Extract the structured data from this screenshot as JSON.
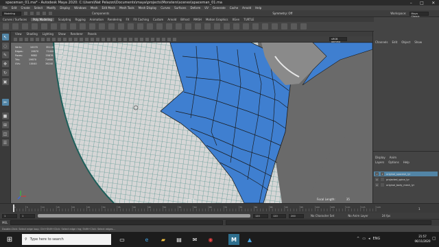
{
  "window": {
    "title": "spaceman_01.ma* - Autodesk Maya 2020: C:\\Users\\Nat Pelazzo\\Documents\\maya\\projects\\Monsters\\scenes\\spaceman_01.ma",
    "controls": [
      "–",
      "□",
      "✕"
    ]
  },
  "menubar": [
    "File",
    "Edit",
    "Create",
    "Select",
    "Modify",
    "Display",
    "Windows",
    "Mesh",
    "Edit Mesh",
    "Mesh Tools",
    "Mesh Display",
    "Curves",
    "Surfaces",
    "Deform",
    "UV",
    "Generate",
    "Cache",
    "Arnold",
    "Help"
  ],
  "status_line": {
    "mode": "Modeling",
    "components": "Components",
    "symmetry": "Symmetry: Off",
    "workspace_label": "Workspace:",
    "workspace": "Maya Classic"
  },
  "shelf_tabs": [
    "Curves / Surfaces",
    "Poly Modeling",
    "Sculpting",
    "Rigging",
    "Animation",
    "Rendering",
    "FX",
    "FX Caching",
    "Custom",
    "Arnold",
    "Bifrost",
    "MASH",
    "Motion Graphics",
    "XGen",
    "TURTLE"
  ],
  "shelf_active": "Poly Modeling",
  "panel_menu": [
    "View",
    "Shading",
    "Lighting",
    "Show",
    "Renderer",
    "Panels"
  ],
  "heads_up": {
    "headers": [
      "",
      "",
      "",
      ""
    ],
    "rows": [
      {
        "label": "Verts:",
        "a": "10070",
        "b": "35116",
        "c": "0"
      },
      {
        "label": "Edges:",
        "a": "19870",
        "b": "71000",
        "c": "0"
      },
      {
        "label": "Faces:",
        "a": "9882",
        "b": "35878",
        "c": "0"
      },
      {
        "label": "Tris:",
        "a": "19670",
        "b": "71666",
        "c": "0"
      },
      {
        "label": "UVs:",
        "a": "10040",
        "b": "36240",
        "c": "0"
      }
    ]
  },
  "camera_name": "persp",
  "focal_length": {
    "label": "Focal Length:",
    "value": "35"
  },
  "toolbar_fields": {
    "gamma": "sRGB gamma"
  },
  "channel_box": {
    "tabs": [
      "Channels",
      "Edit",
      "Object",
      "Show"
    ],
    "layer_tabs": [
      "Display",
      "Anim"
    ],
    "layer_menu": [
      "Layers",
      "Options",
      "Help"
    ],
    "layers": [
      {
        "vis": "V",
        "type": "P",
        "name": "original_spacesh_lyr",
        "selected": true
      },
      {
        "vis": "V",
        "type": "",
        "name": "projected_spine_lyr",
        "selected": false
      },
      {
        "vis": "V",
        "type": "",
        "name": "original_body_mesh_lyr",
        "selected": false
      }
    ]
  },
  "timeline": {
    "ticks": [
      "1",
      "5",
      "10",
      "15",
      "20",
      "25",
      "30",
      "35",
      "40",
      "45",
      "50",
      "55",
      "60",
      "65",
      "70",
      "75",
      "80",
      "85",
      "90",
      "95",
      "100",
      "105",
      "110",
      "115",
      "120"
    ],
    "current": "1"
  },
  "range": {
    "start": "1",
    "start2": "1",
    "end": "120",
    "end2": "120",
    "end3": "200",
    "char_set": "No Character Set",
    "anim_layer": "No Anim Layer",
    "fps": "24 fps"
  },
  "mel": {
    "label": "MEL"
  },
  "help_line": "Double-Click: Select edge loop; Ctrl+Shift+Click: Select edge ring; Shift+Click: Select edges...",
  "taskbar": {
    "search_placeholder": "Type here to search",
    "icons": [
      "task-view-icon",
      "edge-icon",
      "file-explorer-icon",
      "store-icon",
      "mail-icon",
      "chrome-icon",
      "maya-icon",
      "photos-icon"
    ],
    "lang": "ENG",
    "time": "21:57",
    "date": "06/11/2020"
  },
  "colors": {
    "accent": "#5285a6",
    "mesh_blue": "#3f7fd0",
    "viewport_bg": "#6a6a6a",
    "wire": "#2c7f78"
  }
}
